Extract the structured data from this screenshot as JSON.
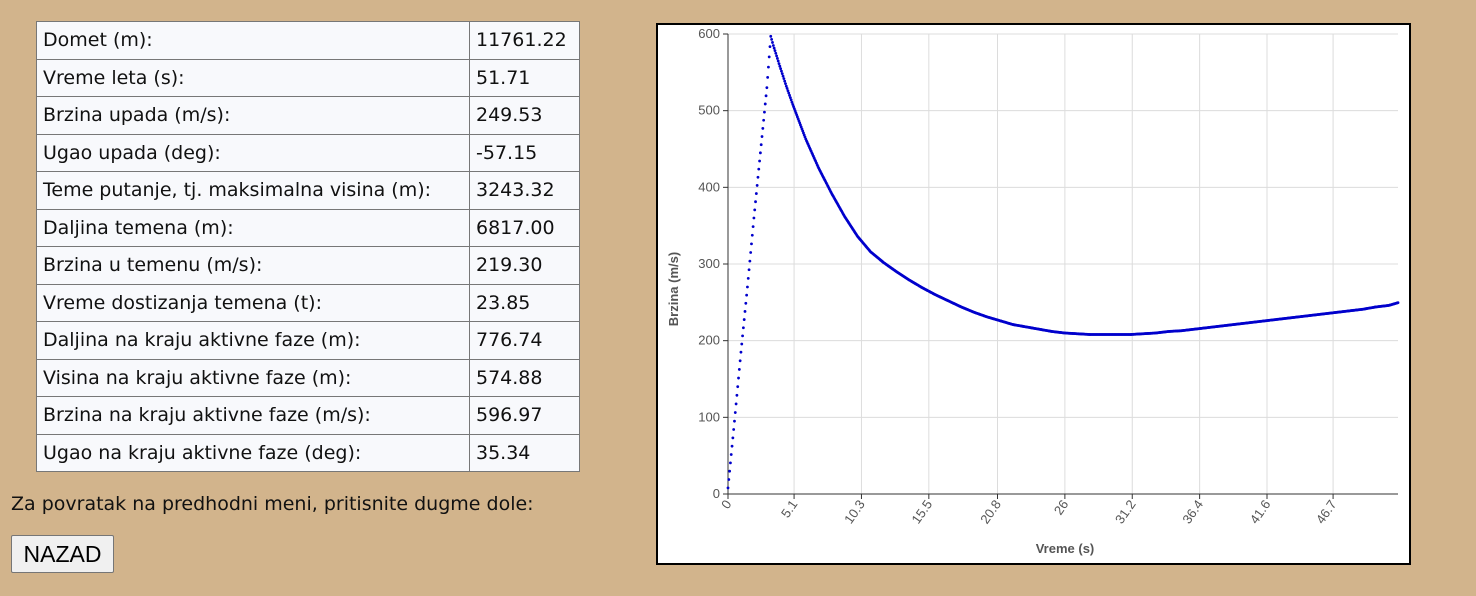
{
  "results": [
    {
      "label": "Domet (m):",
      "value": "11761.22"
    },
    {
      "label": "Vreme leta (s):",
      "value": "51.71"
    },
    {
      "label": "Brzina upada (m/s):",
      "value": "249.53"
    },
    {
      "label": "Ugao upada (deg):",
      "value": "-57.15"
    },
    {
      "label": "Teme putanje, tj. maksimalna visina (m):",
      "value": "3243.32"
    },
    {
      "label": "Daljina temena (m):",
      "value": "6817.00"
    },
    {
      "label": "Brzina u temenu (m/s):",
      "value": "219.30"
    },
    {
      "label": "Vreme dostizanja temena (t):",
      "value": "23.85"
    },
    {
      "label": "Daljina na kraju aktivne faze (m):",
      "value": "776.74"
    },
    {
      "label": "Visina na kraju aktivne faze (m):",
      "value": "574.88"
    },
    {
      "label": "Brzina na kraju aktivne faze (m/s):",
      "value": "596.97"
    },
    {
      "label": "Ugao na kraju aktivne faze (deg):",
      "value": "35.34"
    }
  ],
  "back_text": "Za povratak na predhodni meni, pritisnite dugme dole:",
  "back_button": "NAZAD",
  "chart_data": {
    "type": "scatter",
    "xlabel": "Vreme (s)",
    "ylabel": "Brzina (m/s)",
    "xlim": [
      0,
      51.71
    ],
    "ylim": [
      0,
      600
    ],
    "x_ticks": [
      "0",
      "5.1",
      "10.3",
      "15.5",
      "20.8",
      "26",
      "31.2",
      "36.4",
      "41.6",
      "46.7"
    ],
    "y_ticks": [
      0,
      100,
      200,
      300,
      400,
      500,
      600
    ],
    "grid": true,
    "marker_color": "#0000cc",
    "series": [
      {
        "x": [
          0,
          0.5,
          1,
          1.5,
          2,
          2.5,
          3,
          3.3,
          3.5,
          4,
          4.5,
          5,
          6,
          7,
          8,
          9,
          10,
          11,
          12,
          13,
          14,
          15,
          16,
          17,
          18,
          19,
          20,
          21,
          22,
          23,
          24,
          25,
          26,
          27,
          28,
          29,
          30,
          31,
          32,
          33,
          34,
          35,
          36,
          37,
          38,
          39,
          40,
          41,
          42,
          43,
          44,
          45,
          46,
          47,
          48,
          49,
          50,
          51,
          51.71
        ],
        "y": [
          8,
          95,
          185,
          270,
          360,
          445,
          530,
          596.97,
          585,
          558,
          532,
          508,
          463,
          425,
          392,
          362,
          336,
          316,
          302,
          290,
          279,
          269,
          260,
          252,
          244,
          237,
          231,
          226,
          221,
          218,
          215,
          212,
          210,
          209,
          208,
          208,
          208,
          208,
          209,
          210,
          212,
          213,
          215,
          217,
          219,
          221,
          223,
          225,
          227,
          229,
          231,
          233,
          235,
          237,
          239,
          241,
          244,
          246,
          249.53
        ]
      }
    ]
  }
}
